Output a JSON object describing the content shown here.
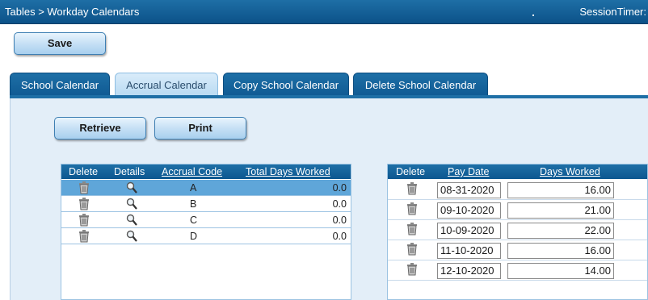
{
  "header": {
    "breadcrumb": "Tables > Workday Calendars",
    "session_timer_label": "SessionTimer:"
  },
  "toolbar": {
    "save_label": "Save"
  },
  "tabs": [
    {
      "label": "School Calendar",
      "active": false
    },
    {
      "label": "Accrual Calendar",
      "active": true
    },
    {
      "label": "Copy School Calendar",
      "active": false
    },
    {
      "label": "Delete School Calendar",
      "active": false
    }
  ],
  "actions": {
    "retrieve_label": "Retrieve",
    "print_label": "Print"
  },
  "accrual_grid": {
    "columns": [
      "Delete",
      "Details",
      "Accrual Code",
      "Total Days Worked"
    ],
    "rows": [
      {
        "code": "A",
        "total": "0.0",
        "selected": true
      },
      {
        "code": "B",
        "total": "0.0",
        "selected": false
      },
      {
        "code": "C",
        "total": "0.0",
        "selected": false
      },
      {
        "code": "D",
        "total": "0.0",
        "selected": false
      }
    ]
  },
  "paydate_grid": {
    "columns": [
      "Delete",
      "Pay Date",
      "Days Worked"
    ],
    "rows": [
      {
        "pay_date": "08-31-2020",
        "days_worked": "16.00"
      },
      {
        "pay_date": "09-10-2020",
        "days_worked": "21.00"
      },
      {
        "pay_date": "10-09-2020",
        "days_worked": "22.00"
      },
      {
        "pay_date": "11-10-2020",
        "days_worked": "16.00"
      },
      {
        "pay_date": "12-10-2020",
        "days_worked": "14.00"
      }
    ]
  },
  "icons": {
    "delete": "trash-icon",
    "details": "magnifier-icon"
  },
  "colors": {
    "header_blue": "#1e6fa6",
    "selected_row": "#5fa6d9",
    "panel_bg": "#e3eef8"
  }
}
